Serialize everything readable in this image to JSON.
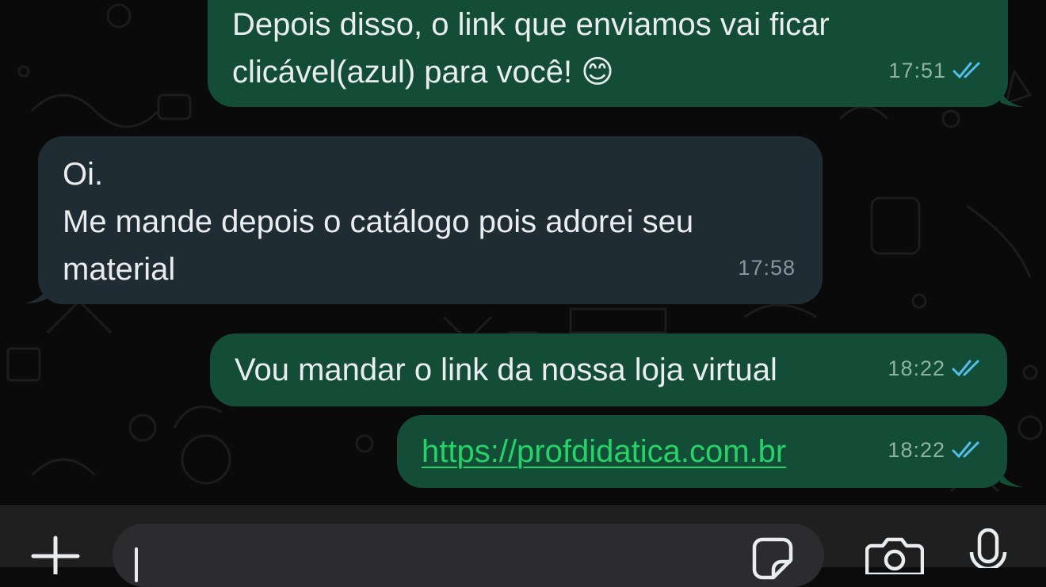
{
  "messages": [
    {
      "direction": "outgoing",
      "text": "Depois disso, o link que enviamos vai ficar\nclicável(azul) para você! 😊",
      "time": "17:51",
      "status": "read"
    },
    {
      "direction": "incoming",
      "text": "Oi.\nMe mande depois o catálogo pois adorei seu\nmaterial",
      "time": "17:58"
    },
    {
      "direction": "outgoing",
      "text": "Vou mandar o link da nossa loja virtual",
      "time": "18:22",
      "status": "read"
    },
    {
      "direction": "outgoing",
      "text": "https://profdidatica.com.br",
      "is_link": true,
      "time": "18:22",
      "status": "read"
    }
  ],
  "composer": {
    "icons": [
      "plus-icon",
      "sticker-icon",
      "camera-icon",
      "microphone-icon"
    ]
  },
  "colors": {
    "outgoing_bubble": "#134d37",
    "incoming_bubble": "#202c33",
    "link": "#25d366",
    "read_ticks": "#53bdeb"
  }
}
